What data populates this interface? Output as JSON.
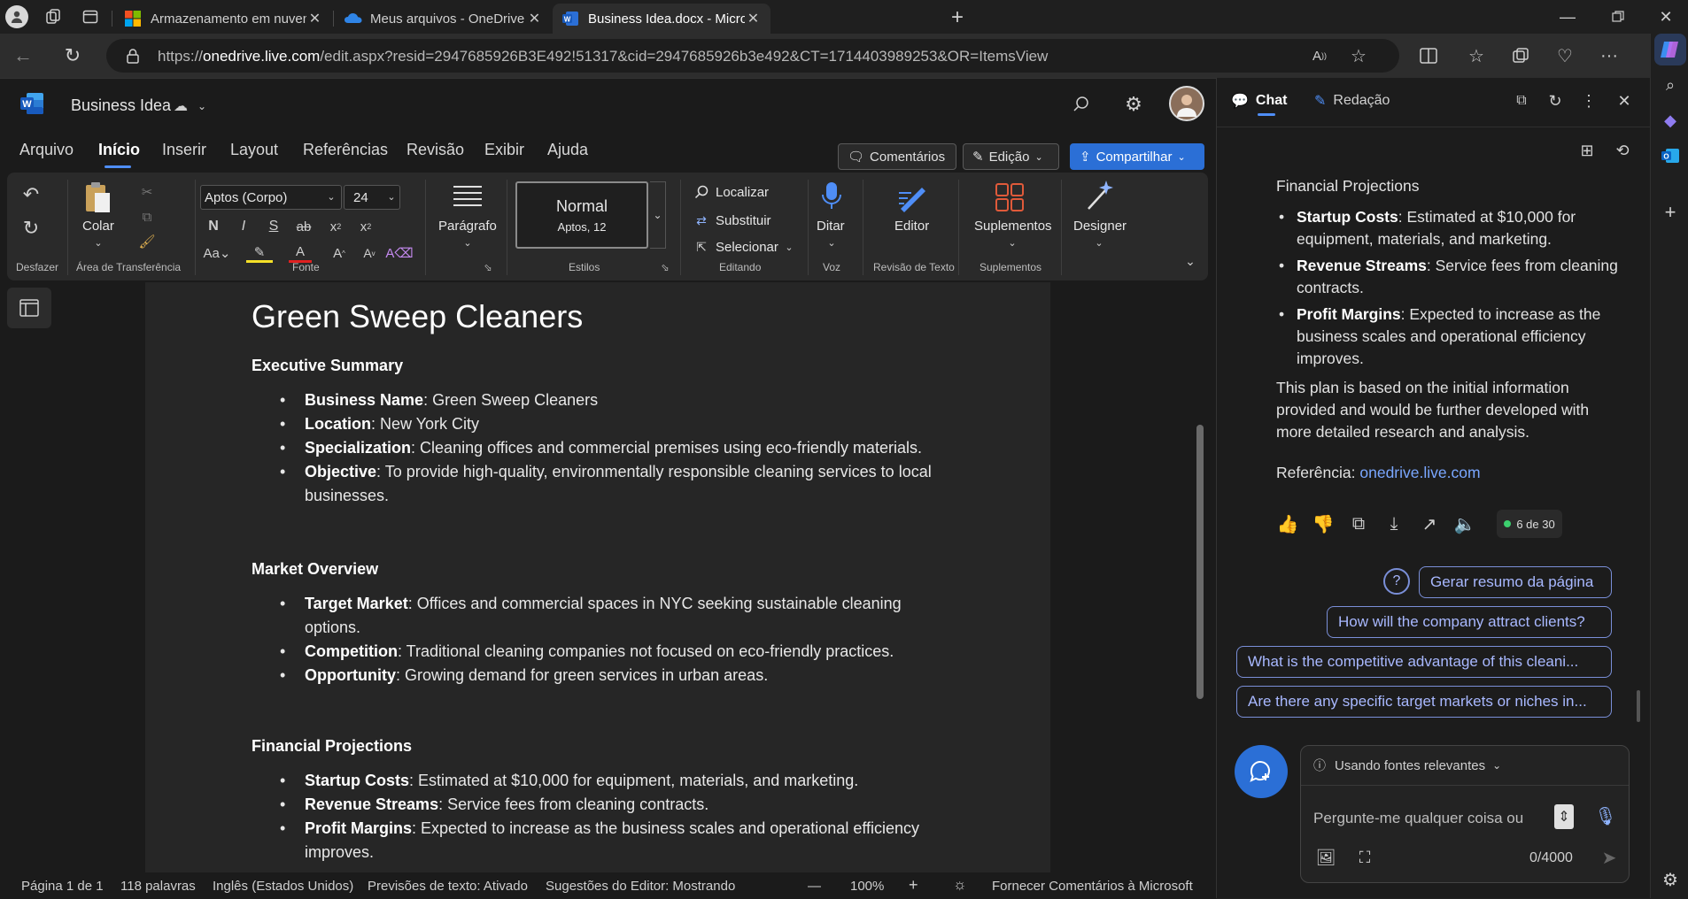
{
  "browser": {
    "tabs": [
      {
        "label": "Armazenamento em nuvem pess"
      },
      {
        "label": "Meus arquivos - OneDrive"
      },
      {
        "label": "Business Idea.docx - Microsoft W"
      }
    ],
    "url_prefix": "https://",
    "url_host": "onedrive.live.com",
    "url_rest": "/edit.aspx?resid=2947685926B3E492!51317&cid=2947685926b3e492&CT=1714403989253&OR=ItemsView"
  },
  "word": {
    "doc_name": "Business Idea",
    "menu": [
      "Arquivo",
      "Início",
      "Inserir",
      "Layout",
      "Referências",
      "Revisão",
      "Exibir",
      "Ajuda"
    ],
    "comments_label": "Comentários",
    "edit_label": "Edição",
    "share_label": "Compartilhar",
    "ribbon": {
      "undo_group": "Desfazer",
      "paste_label": "Colar",
      "clipboard_group": "Área de Transferência",
      "font_name": "Aptos (Corpo)",
      "font_size": "24",
      "font_group": "Fonte",
      "paragraph_label": "Parágrafo",
      "style_name": "Normal",
      "style_sub": "Aptos, 12",
      "styles_group": "Estilos",
      "find_label": "Localizar",
      "replace_label": "Substituir",
      "select_label": "Selecionar",
      "editing_group": "Editando",
      "dictate_label": "Ditar",
      "voice_group": "Voz",
      "editor_label": "Editor",
      "review_group": "Revisão de Texto",
      "addins_label": "Suplementos",
      "addins_group": "Suplementos",
      "designer_label": "Designer"
    },
    "doc": {
      "title": "Green Sweep Cleaners",
      "sec1": "Executive Summary",
      "sec1_items": [
        {
          "k": "Business Name",
          "v": ": Green Sweep Cleaners"
        },
        {
          "k": "Location",
          "v": ": New York City"
        },
        {
          "k": "Specialization",
          "v": ": Cleaning offices and commercial premises using eco-friendly materials."
        },
        {
          "k": "Objective",
          "v": ": To provide high-quality, environmentally responsible cleaning services to local businesses."
        }
      ],
      "sec2": "Market Overview",
      "sec2_items": [
        {
          "k": "Target Market",
          "v": ": Offices and commercial spaces in NYC seeking sustainable cleaning options."
        },
        {
          "k": "Competition",
          "v": ": Traditional cleaning companies not focused on eco-friendly practices."
        },
        {
          "k": "Opportunity",
          "v": ": Growing demand for green services in urban areas."
        }
      ],
      "sec3": "Financial Projections",
      "sec3_items": [
        {
          "k": "Startup Costs",
          "v": ": Estimated at $10,000 for equipment, materials, and marketing."
        },
        {
          "k": "Revenue Streams",
          "v": ": Service fees from cleaning contracts."
        },
        {
          "k": "Profit Margins",
          "v": ": Expected to increase as the business scales and operational efficiency improves."
        }
      ]
    },
    "status": {
      "page": "Página 1 de 1",
      "words": "118 palavras",
      "lang": "Inglês (Estados Unidos)",
      "predictions": "Previsões de texto: Ativado",
      "suggestions": "Sugestões do Editor: Mostrando",
      "zoom": "100%",
      "feedback": "Fornecer Comentários à Microsoft"
    }
  },
  "copilot": {
    "tab_chat": "Chat",
    "tab_compose": "Redação",
    "heading": "Financial Projections",
    "bullets": [
      {
        "k": "Startup Costs",
        "v": ": Estimated at $10,000 for equipment, materials, and marketing."
      },
      {
        "k": "Revenue Streams",
        "v": ": Service fees from cleaning contracts."
      },
      {
        "k": "Profit Margins",
        "v": ": Expected to increase as the business scales and operational efficiency improves."
      }
    ],
    "closing": "This plan is based on the initial information provided and would be further developed with more detailed research and analysis.",
    "ref_label": "Referência:",
    "ref_link": "onedrive.live.com",
    "counter": "6 de 30",
    "suggestions": [
      "Gerar resumo da página",
      "How will the company attract clients?",
      "What is the competitive advantage of this cleani...",
      "Are there any specific target markets or niches in..."
    ],
    "sources_label": "Usando fontes relevantes",
    "input_placeholder": "Pergunte-me qualquer coisa ou",
    "char_count": "0/4000"
  },
  "colors": {
    "accent": "#4f8ef7",
    "share": "#2b6fd6",
    "link": "#7aa7ff"
  }
}
